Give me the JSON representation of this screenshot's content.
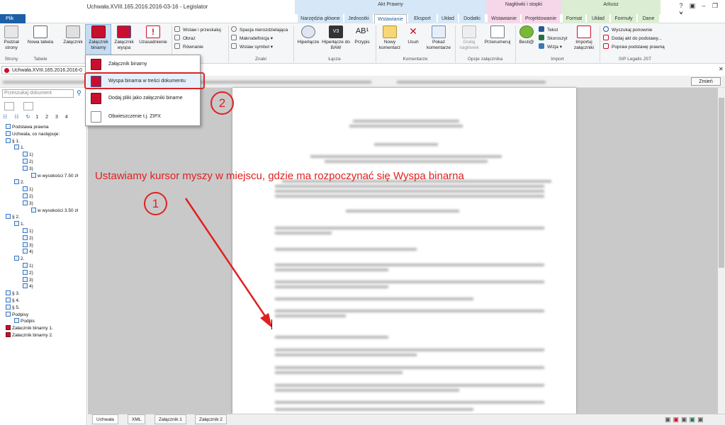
{
  "window": {
    "title": "Uchwała.XVIII.165.2016.2016-03-16 - Legislator"
  },
  "context_groups": [
    {
      "label": "Akt Prawny",
      "color": "#d6e8f7"
    },
    {
      "label": "Nagłówki i stopki",
      "color": "#f6d7ea"
    },
    {
      "label": "Arkusz",
      "color": "#dbeed3"
    }
  ],
  "tabs": {
    "file": "Plik",
    "items": [
      "Narzędzia główne",
      "Jednostki",
      "Wstawianie",
      "Eksport",
      "Układ",
      "Dodatki",
      "Wstawianie",
      "Projektowanie",
      "Format",
      "Układ",
      "Formuły",
      "Dane"
    ]
  },
  "ribbon": {
    "buttons": {
      "podzial": "Podział strony",
      "nowa_tabela": "Nowa tabela",
      "zalacznik": "Załącznik",
      "zalacznik_binarny": "Załącznik binarny",
      "zalacznik_wyspa": "Załącznik wyspa",
      "uzasadnienie": "Uzasadnienie",
      "hiperlacze": "Hiperłącze",
      "hiperlacze_baw": "Hiperłącze do BAW",
      "przypis": "Przypis",
      "nowy_komentarz": "Nowy komentarz",
      "usun": "Usuń",
      "pokaz_komentarze": "Pokaż komentarze",
      "dodaj_naglowek": "Dodaj nagłówek",
      "przenumeruj": "Przenumeruj",
      "besti": "Besti@",
      "importuj": "Importuj załączniki"
    },
    "small": {
      "wstaw_przeskaluj": "Wstaw i przeskaluj",
      "obraz": "Obraz",
      "rownanie": "Równanie",
      "spacja": "Spacja nierozdzielająca",
      "makro": "Makrodefinicja",
      "symbol": "Wstaw symbol",
      "tekst": "Tekst",
      "skoroszyt": "Skoroszyt",
      "wizja": "Wizja",
      "wyszukaj": "Wyszukaj ponownie",
      "dodaj_akt": "Dodaj akt do podstawy...",
      "popraw": "Popraw podstawę prawną"
    },
    "groups": {
      "strony": "Strony",
      "tabele": "Tabele",
      "znaki": "Znaki",
      "lacza": "Łącza",
      "komentarze": "Komentarze",
      "opcje": "Opcje załącznika",
      "import": "Import",
      "sip": "SIP Legalis JST"
    }
  },
  "document_tab": "Uchwała.XVIII.165.2016.2016-0",
  "infobar": {
    "button": "Zmień"
  },
  "search": {
    "placeholder": "Przeszukaj dokument"
  },
  "outline_levels": [
    "1",
    "2",
    "3",
    "4"
  ],
  "tree": [
    {
      "label": "Podstawa prawna",
      "indent": 0
    },
    {
      "label": "Uchwala, co następuje:",
      "indent": 0
    },
    {
      "label": "§ 1.",
      "indent": 0
    },
    {
      "label": "1.",
      "indent": 1
    },
    {
      "label": "1)",
      "indent": 2
    },
    {
      "label": "2)",
      "indent": 2
    },
    {
      "label": "3)",
      "indent": 2
    },
    {
      "label": "w wysokości 7.50 zł",
      "indent": 3
    },
    {
      "label": "2.",
      "indent": 1
    },
    {
      "label": "1)",
      "indent": 2
    },
    {
      "label": "2)",
      "indent": 2
    },
    {
      "label": "3)",
      "indent": 2
    },
    {
      "label": "w wysokości 3.50 zł",
      "indent": 3
    },
    {
      "label": "§ 2.",
      "indent": 0
    },
    {
      "label": "1.",
      "indent": 1
    },
    {
      "label": "1)",
      "indent": 2
    },
    {
      "label": "2)",
      "indent": 2
    },
    {
      "label": "3)",
      "indent": 2
    },
    {
      "label": "4)",
      "indent": 2
    },
    {
      "label": "2.",
      "indent": 1
    },
    {
      "label": "1)",
      "indent": 2
    },
    {
      "label": "2)",
      "indent": 2
    },
    {
      "label": "3)",
      "indent": 2
    },
    {
      "label": "4)",
      "indent": 2
    },
    {
      "label": "§ 3.",
      "indent": 0
    },
    {
      "label": "§ 4.",
      "indent": 0
    },
    {
      "label": "§ 5.",
      "indent": 0
    },
    {
      "label": "Podpisy",
      "indent": 0
    },
    {
      "label": "Podpis",
      "indent": 1
    },
    {
      "label": "Załacznik binarny 1.",
      "indent": 0
    },
    {
      "label": "Załacznik binarny 2.",
      "indent": 0
    }
  ],
  "dropdown": [
    "Załącznik binarny",
    "Wyspa binarna w treści dokumentu",
    "Dodaj pliki jako załączniki binarne",
    "Obwieszczenie t.j. ZIPX"
  ],
  "annotation": {
    "instruction": "Ustawiamy kursor myszy w miejscu, gdzie ma rozpoczynać się Wyspa binarna",
    "step1": "1",
    "step2": "2"
  },
  "bottom_tabs": [
    "Uchwała",
    "XML",
    "Załącznik 1",
    "Załącznik 2"
  ]
}
